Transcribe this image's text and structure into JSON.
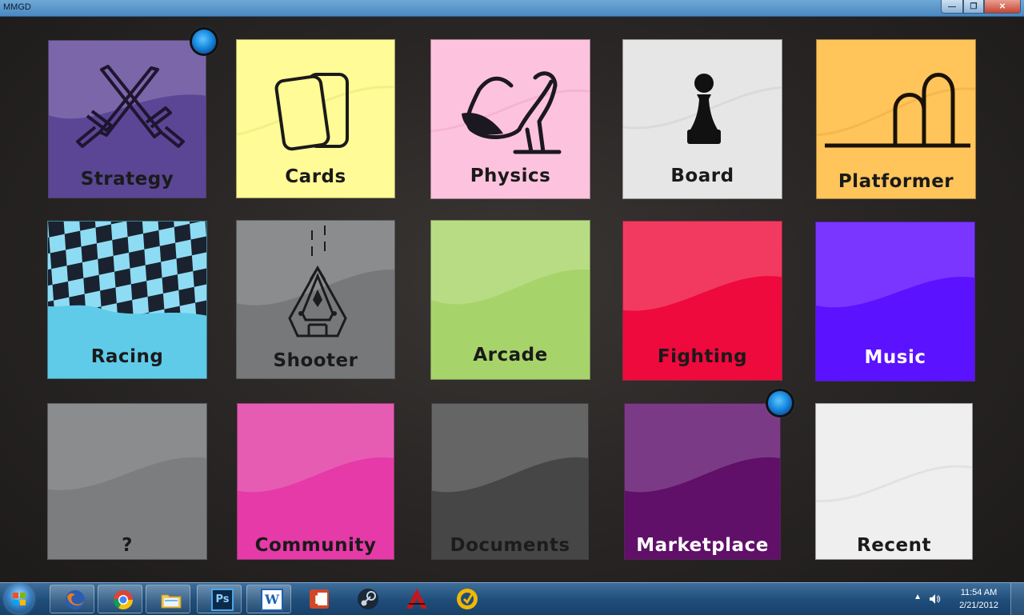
{
  "window": {
    "title": "MMGD"
  },
  "tiles": [
    {
      "label": "Strategy",
      "color": "#6a4c9c",
      "icon": "crossed-swords-icon"
    },
    {
      "label": "Cards",
      "color": "#fffb96",
      "icon": "cards-icon"
    },
    {
      "label": "Physics",
      "color": "#fdc3de",
      "icon": "slingshot-icon"
    },
    {
      "label": "Board",
      "color": "#e6e6e6",
      "icon": "chess-pawn-icon"
    },
    {
      "label": "Platformer",
      "color": "#ffc55a",
      "icon": "platform-arches-icon"
    },
    {
      "label": "Racing",
      "color": "#5fcbe8",
      "icon": "checkered-flag-icon"
    },
    {
      "label": "Shooter",
      "color": "#8a8c8e",
      "icon": "spaceship-icon"
    },
    {
      "label": "Arcade",
      "color": "#a6d46a",
      "icon": ""
    },
    {
      "label": "Fighting",
      "color": "#ee0a3c",
      "icon": ""
    },
    {
      "label": "Music",
      "color": "#5a12ff",
      "icon": ""
    },
    {
      "label": "?",
      "color": "#7b7d7f",
      "icon": ""
    },
    {
      "label": "Community",
      "color": "#e63aa8",
      "icon": ""
    },
    {
      "label": "Documents",
      "color": "#4a4a4a",
      "icon": ""
    },
    {
      "label": "Marketplace",
      "color": "#6b1c78",
      "icon": ""
    },
    {
      "label": "Recent",
      "color": "#efefef",
      "icon": ""
    }
  ],
  "taskbar": {
    "apps": [
      "firefox-icon",
      "chrome-icon",
      "explorer-folder-icon",
      "photoshop-icon",
      "word-icon",
      "powerpoint-icon",
      "steam-icon",
      "autodesk-icon",
      "app-icon"
    ],
    "photoshop_text": "Ps",
    "word_text": "W",
    "clock_time": "11:54 AM",
    "clock_date": "2/21/2012"
  }
}
